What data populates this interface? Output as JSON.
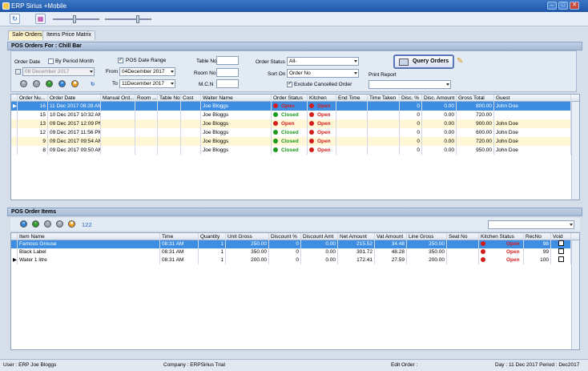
{
  "window": {
    "title": "ERP Sirius +Mobile",
    "buttons": [
      "–",
      "□",
      "✕"
    ]
  },
  "tabs": [
    "Sale Orders",
    "Items Price Matrix"
  ],
  "pos_orders": {
    "section_title": "POS Orders For : Chill Bar",
    "order_date_label": "Order Date",
    "order_date_value": "08 December 2017",
    "by_period_label": "By Period Month",
    "pos_date_range_label": "POS Date Range",
    "from_label": "From",
    "from_value": "04December 2017",
    "to_label": "To",
    "to_value": "11December 2017",
    "table_no_label": "Table No",
    "room_no_label": "Room No",
    "mcn_label": "M.C.N",
    "order_status_label": "Order Status",
    "order_status_value": "All-",
    "sort_on_label": "Sort On",
    "sort_on_value": "Order No",
    "exclude_cancelled_label": "Exclude Cancelled Order",
    "query_button": "Query Orders",
    "print_report_label": "Print Report",
    "columns": [
      "Order Nu...",
      "Order Date",
      "Manual Ord...",
      "Room ...",
      "Table No",
      "Cost",
      "Waiter Name",
      "Order Status",
      "Kitchen",
      "End Time",
      "Time Taken",
      "Disc. %",
      "Disc. Amount",
      "Gross Total",
      "Guest"
    ],
    "rows": [
      {
        "no": "16",
        "date": "11 Dec 2017 08:28 AM",
        "waiter": "Joe Bloggs",
        "status": "Open",
        "kitchen": "Open",
        "disc_pct": "0",
        "disc_amt": "0.00",
        "gross": "800.00",
        "guest": "John Doe"
      },
      {
        "no": "15",
        "date": "10 Dec 2017 10:32 AM",
        "waiter": "Joe Bloggs",
        "status": "Closed",
        "kitchen": "Open",
        "disc_pct": "0",
        "disc_amt": "0.00",
        "gross": "720.00",
        "guest": ""
      },
      {
        "no": "13",
        "date": "09 Dec 2017 12:09 PM",
        "waiter": "Joe Bloggs",
        "status": "Open",
        "kitchen": "Open",
        "disc_pct": "0",
        "disc_amt": "0.00",
        "gross": "900.00",
        "guest": "John Doe"
      },
      {
        "no": "12",
        "date": "09 Dec 2017 11:56 PM",
        "waiter": "Joe Bloggs",
        "status": "Closed",
        "kitchen": "Open",
        "disc_pct": "0",
        "disc_amt": "0.00",
        "gross": "600.00",
        "guest": "John Doe"
      },
      {
        "no": "9",
        "date": "09 Dec 2017 09:54 AM",
        "waiter": "Joe Bloggs",
        "status": "Closed",
        "kitchen": "Open",
        "disc_pct": "0",
        "disc_amt": "0.00",
        "gross": "720.00",
        "guest": "John Doe"
      },
      {
        "no": "8",
        "date": "09 Dec 2017 09:50 AM",
        "waiter": "Joe Bloggs",
        "status": "Closed",
        "kitchen": "Open",
        "disc_pct": "0",
        "disc_amt": "0.00",
        "gross": "950.00",
        "guest": "John Doe"
      }
    ]
  },
  "order_items": {
    "section_title": "POS Order Items",
    "count": "122",
    "columns": [
      "Item Name",
      "Time",
      "Quantity",
      "Unit Gross",
      "Discount %",
      "Discount Amt",
      "Net Amount",
      "Vat Amount",
      "Line Gross",
      "Seat No",
      "Kitchen Status",
      "RecNo",
      "Void"
    ],
    "rows": [
      {
        "name": "Famous Grouse",
        "time": "08:31 AM",
        "qty": "1",
        "unit": "250.00",
        "dpct": "0",
        "damt": "0.00",
        "net": "215.52",
        "vat": "34.48",
        "line": "250.00",
        "seat": "",
        "kstatus": "Open",
        "rec": "98"
      },
      {
        "name": "Black Label",
        "time": "08:31 AM",
        "qty": "1",
        "unit": "350.00",
        "dpct": "0",
        "damt": "0.00",
        "net": "301.72",
        "vat": "48.28",
        "line": "350.00",
        "seat": "",
        "kstatus": "Open",
        "rec": "99"
      },
      {
        "name": "Water 1 litre",
        "time": "08:31 AM",
        "qty": "1",
        "unit": "200.00",
        "dpct": "0",
        "damt": "0.00",
        "net": "172.41",
        "vat": "27.59",
        "line": "200.00",
        "seat": "",
        "kstatus": "Open",
        "rec": "100"
      }
    ]
  },
  "status_bar": {
    "user": "User : ERP Joe Bloggs",
    "company": "Company : ERPSirius Trial",
    "edit_order": "Edit Order :",
    "day_period": "Day : 11 Dec 2017  Period : Dec2017"
  },
  "colors": {
    "accent": "#3d8ee3",
    "open": "#d21d1d",
    "closed": "#1b9a1b"
  }
}
